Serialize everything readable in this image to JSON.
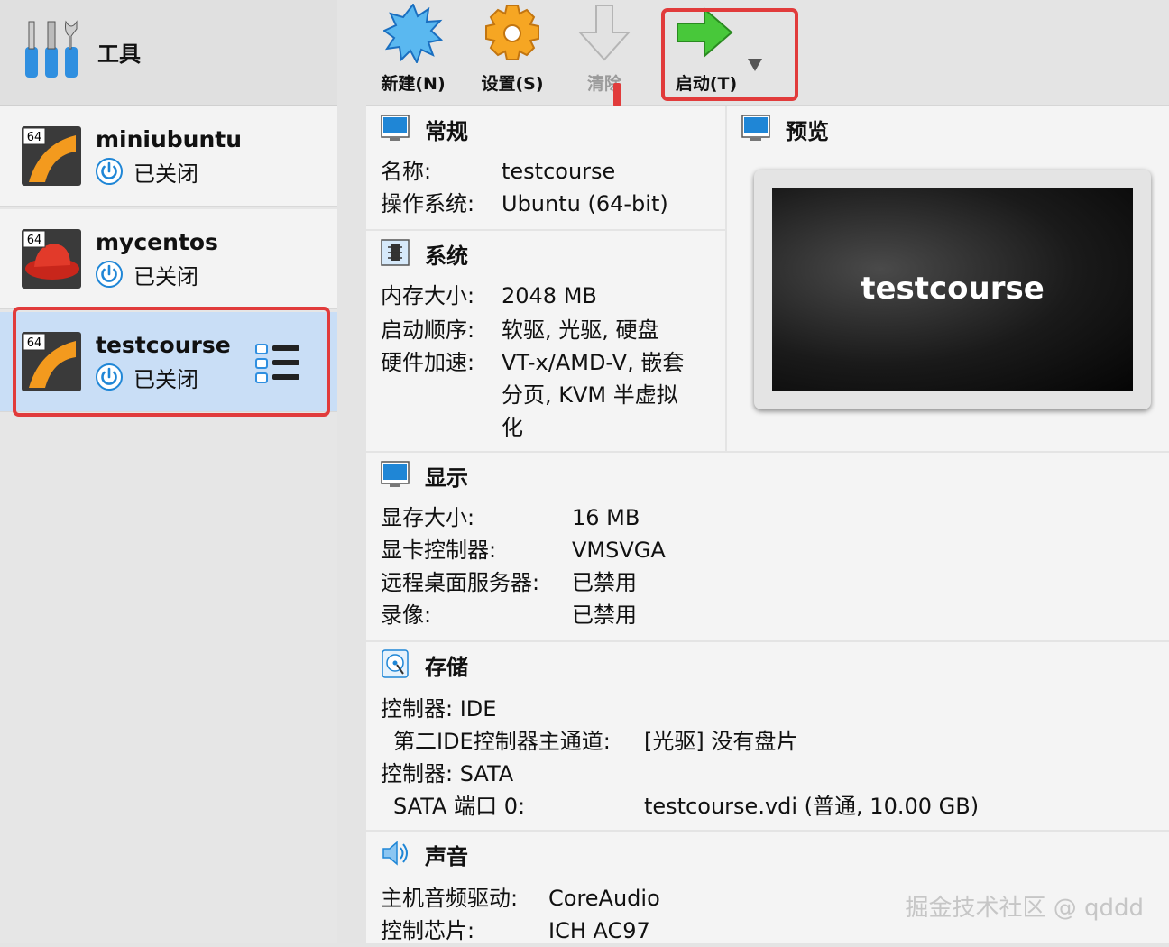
{
  "sidebar": {
    "tools_label": "工具",
    "vms": [
      {
        "name": "miniubuntu",
        "status": "已关闭",
        "badge": "64"
      },
      {
        "name": "mycentos",
        "status": "已关闭",
        "badge": "64"
      },
      {
        "name": "testcourse",
        "status": "已关闭",
        "badge": "64"
      }
    ]
  },
  "toolbar": {
    "new_label": "新建(N)",
    "settings_label": "设置(S)",
    "discard_label": "清除",
    "start_label": "启动(T)"
  },
  "general": {
    "title": "常规",
    "name_label": "名称:",
    "name_value": "testcourse",
    "os_label": "操作系统:",
    "os_value": "Ubuntu (64-bit)"
  },
  "preview": {
    "title": "预览",
    "screen_text": "testcourse"
  },
  "system": {
    "title": "系统",
    "memory_label": "内存大小:",
    "memory_value": "2048 MB",
    "boot_label": "启动顺序:",
    "boot_value": "软驱, 光驱, 硬盘",
    "accel_label": "硬件加速:",
    "accel_line1": "VT-x/AMD-V, 嵌套",
    "accel_line2": "分页, KVM 半虚拟",
    "accel_line3": "化"
  },
  "display": {
    "title": "显示",
    "vram_label": "显存大小:",
    "vram_value": "16 MB",
    "controller_label": "显卡控制器:",
    "controller_value": "VMSVGA",
    "rdp_label": "远程桌面服务器:",
    "rdp_value": "已禁用",
    "record_label": "录像:",
    "record_value": "已禁用"
  },
  "storage": {
    "title": "存储",
    "ctrl1": "控制器: IDE",
    "ctrl1_port_label": "第二IDE控制器主通道:",
    "ctrl1_port_value": "[光驱] 没有盘片",
    "ctrl2": "控制器: SATA",
    "ctrl2_port_label": "SATA 端口 0:",
    "ctrl2_port_value": "testcourse.vdi (普通, 10.00 GB)"
  },
  "audio": {
    "title": "声音",
    "driver_label": "主机音频驱动:",
    "driver_value": "CoreAudio",
    "chip_label": "控制芯片:",
    "chip_value": "ICH AC97"
  },
  "watermark": "掘金技术社区 @ qddd",
  "colors": {
    "highlight": "#e13b3b",
    "selected_bg": "#c9def6",
    "start_green": "#3fbf2f",
    "power_blue": "#1f86d6"
  }
}
